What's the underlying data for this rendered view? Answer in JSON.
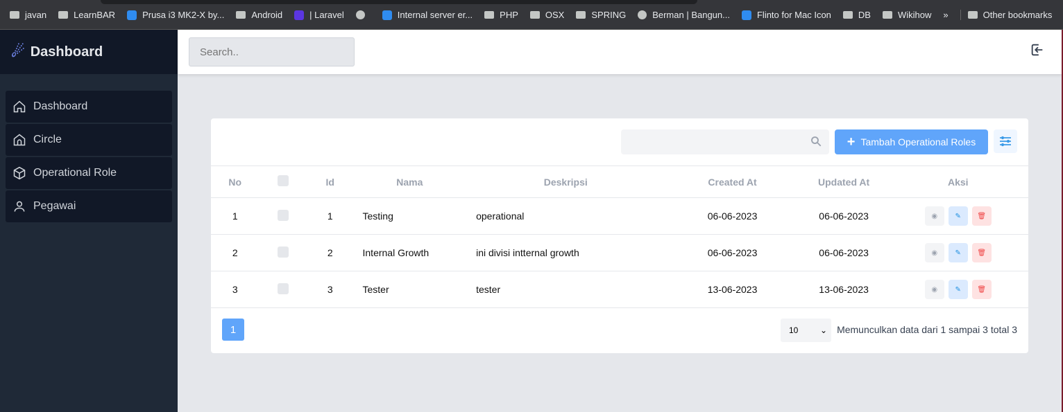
{
  "bookmarks": [
    {
      "label": "javan",
      "icon": "folder-icon"
    },
    {
      "label": "LearnBAR",
      "icon": "folder-icon"
    },
    {
      "label": "Prusa i3 MK2-X by...",
      "icon": "site-icon"
    },
    {
      "label": "Android",
      "icon": "folder-icon"
    },
    {
      "label": "| Laravel",
      "icon": "site-icon"
    },
    {
      "label": "",
      "icon": "globe-icon"
    },
    {
      "label": "Internal server er...",
      "icon": "site-icon"
    },
    {
      "label": "PHP",
      "icon": "folder-icon"
    },
    {
      "label": "OSX",
      "icon": "folder-icon"
    },
    {
      "label": "SPRING",
      "icon": "folder-icon"
    },
    {
      "label": "Berman | Bangun...",
      "icon": "globe-icon"
    },
    {
      "label": "Flinto for Mac Icon",
      "icon": "site-icon"
    },
    {
      "label": "DB",
      "icon": "folder-icon"
    },
    {
      "label": "Wikihow",
      "icon": "folder-icon"
    },
    {
      "label": "»",
      "icon": ""
    },
    {
      "label": "Other bookmarks",
      "icon": "folder-icon"
    }
  ],
  "brand": "Dashboard",
  "sidebar": {
    "items": [
      {
        "label": "Dashboard",
        "icon": "home-icon"
      },
      {
        "label": "Circle",
        "icon": "circle-home-icon"
      },
      {
        "label": "Operational Role",
        "icon": "cube-icon"
      },
      {
        "label": "Pegawai",
        "icon": "user-icon"
      }
    ]
  },
  "header": {
    "search_placeholder": "Search.."
  },
  "toolbar": {
    "add_label": "Tambah Operational Roles"
  },
  "table": {
    "headers": [
      "No",
      "",
      "Id",
      "Nama",
      "Deskripsi",
      "Created At",
      "Updated At",
      "Aksi"
    ],
    "rows": [
      [
        "1",
        "",
        "1",
        "Testing",
        "operational",
        "06-06-2023",
        "06-06-2023"
      ],
      [
        "2",
        "",
        "2",
        "Internal Growth",
        "ini divisi intternal growth",
        "06-06-2023",
        "06-06-2023"
      ],
      [
        "3",
        "",
        "3",
        "Tester",
        "tester",
        "13-06-2023",
        "13-06-2023"
      ]
    ]
  },
  "pagination": {
    "page": "1",
    "per_page": "10",
    "info": "Memunculkan data dari 1 sampai 3 total 3"
  },
  "colors": {
    "primary": "#60a5fa",
    "sidebar": "#1f2937",
    "danger": "#ef4444"
  }
}
